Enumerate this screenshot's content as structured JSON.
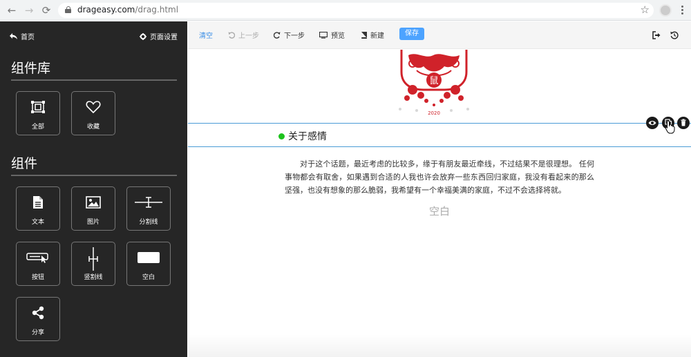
{
  "browser": {
    "url_host": "drageasy.com",
    "url_path": "/drag.html"
  },
  "sidebar": {
    "home_label": "首页",
    "settings_label": "页面设置",
    "library_title": "组件库",
    "library_items": [
      {
        "label": "全部",
        "icon": "select-all-icon"
      },
      {
        "label": "收藏",
        "icon": "heart-icon"
      }
    ],
    "components_title": "组件",
    "components": [
      {
        "label": "文本",
        "icon": "document-icon"
      },
      {
        "label": "图片",
        "icon": "image-icon"
      },
      {
        "label": "分割线",
        "icon": "divider-icon"
      },
      {
        "label": "按钮",
        "icon": "button-icon"
      },
      {
        "label": "竖割线",
        "icon": "vertical-divider-icon"
      },
      {
        "label": "空白",
        "icon": "blank-icon"
      },
      {
        "label": "分享",
        "icon": "share-icon"
      }
    ]
  },
  "toolbar": {
    "clear_label": "清空",
    "undo_label": "上一步",
    "redo_label": "下一步",
    "preview_label": "预览",
    "new_label": "新建",
    "save_label": "保存"
  },
  "canvas": {
    "papercut_char": "鼠",
    "papercut_year": "2020",
    "section_title": "关于感情",
    "paragraph": "对于这个话题，最近考虑的比较多，缘于有朋友最近牵线，不过结果不是很理想。 任何事物都会有取舍，如果遇到合适的人我也许会放弃一些东西回归家庭，我没有看起来的那么坚强，也没有想象的那么脆弱，我希望有一个幸福美满的家庭，不过不会选择将就。",
    "blank_label": "空白"
  },
  "colors": {
    "sidebar_bg": "#262626",
    "accent": "#4da3ff",
    "section_dot": "#1ec31e",
    "papercut_red": "#d0222a"
  }
}
